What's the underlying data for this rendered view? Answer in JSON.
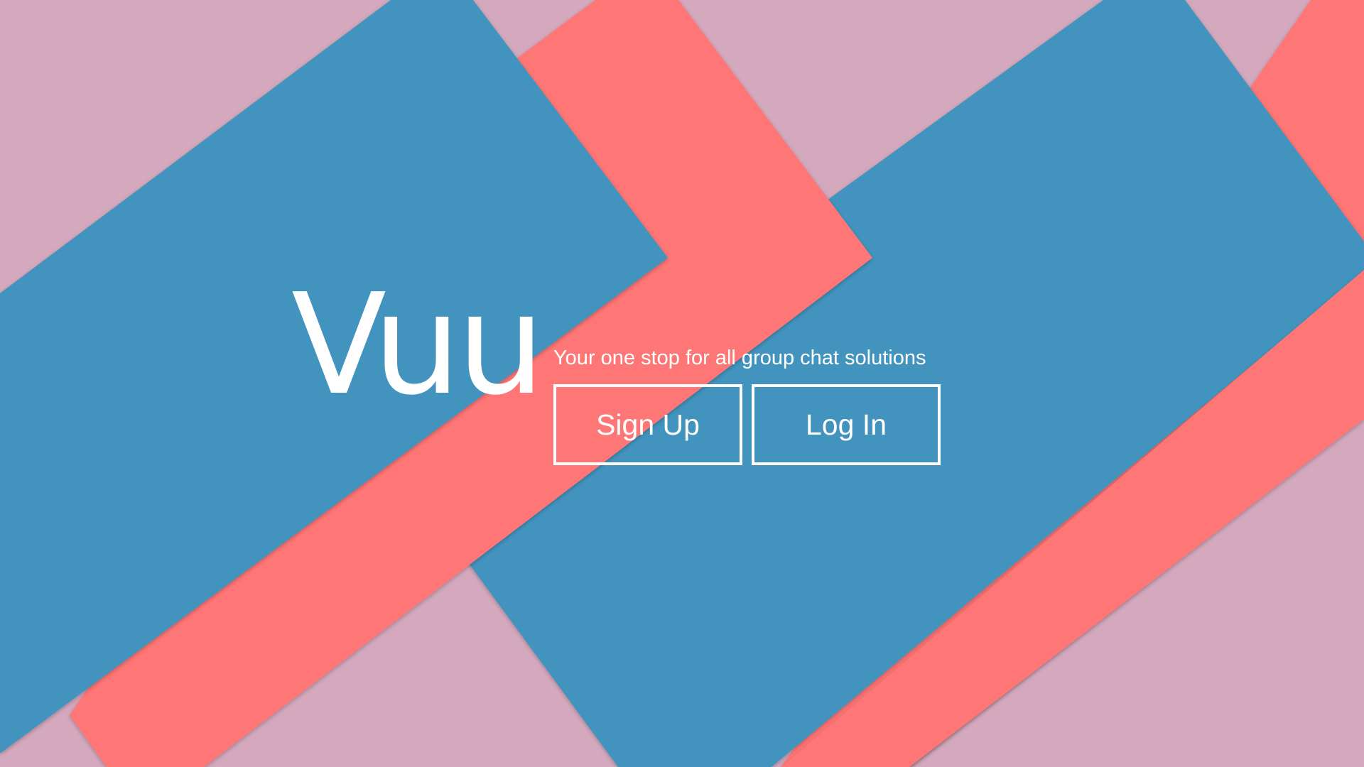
{
  "brand": {
    "name": "Vuu",
    "tagline": "Your one stop for all group chat solutions"
  },
  "actions": {
    "signup_label": "Sign Up",
    "login_label": "Log In"
  },
  "colors": {
    "background": "#d4a9bd",
    "blue_band": "#4394bf",
    "coral_band": "#ff7676",
    "text": "#ffffff"
  }
}
